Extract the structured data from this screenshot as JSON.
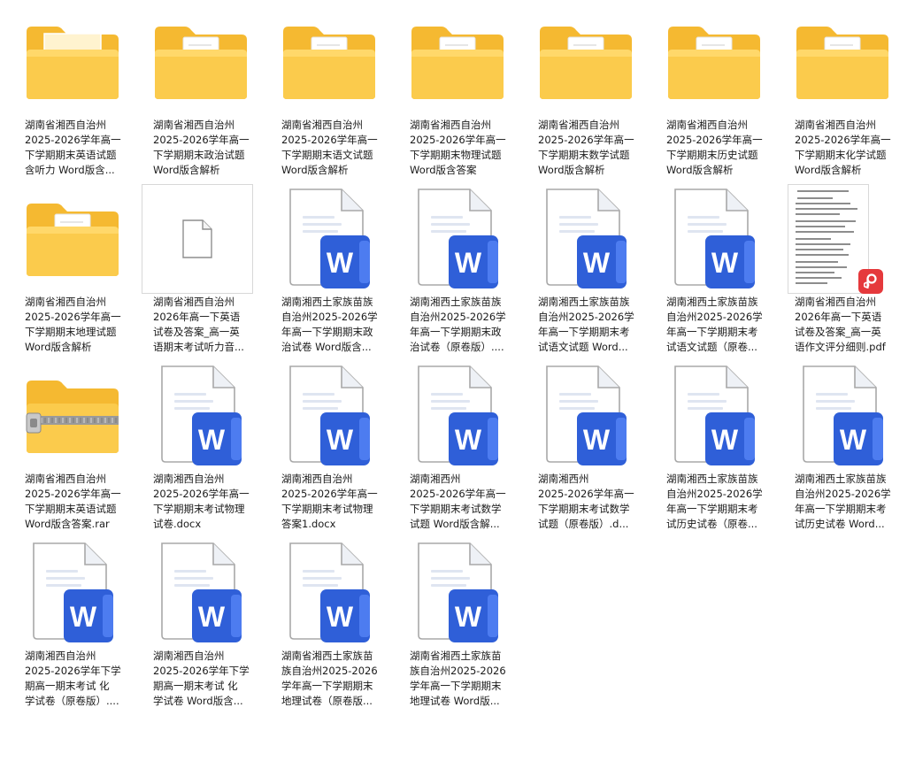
{
  "colors": {
    "folder_back": "#F5B931",
    "folder_front": "#FBCB4C",
    "word_blue": "#2F5FD8",
    "word_blue_light": "#4D7CF0",
    "pdf_red": "#E5393C"
  },
  "files": [
    {
      "type": "folder-image",
      "icon": "folder-icon",
      "lines": [
        "湖南省湘西自治州",
        "2025-2026学年高一",
        "下学期期末英语试题",
        "含听力 Word版含..."
      ]
    },
    {
      "type": "folder-doc",
      "icon": "folder-icon",
      "lines": [
        "湖南省湘西自治州",
        "2025-2026学年高一",
        "下学期期末政治试题",
        "Word版含解析"
      ]
    },
    {
      "type": "folder-doc",
      "icon": "folder-icon",
      "lines": [
        "湖南省湘西自治州",
        "2025-2026学年高一",
        "下学期期末语文试题",
        "Word版含解析"
      ]
    },
    {
      "type": "folder-doc",
      "icon": "folder-icon",
      "lines": [
        "湖南省湘西自治州",
        "2025-2026学年高一",
        "下学期期末物理试题",
        "Word版含答案"
      ]
    },
    {
      "type": "folder-doc",
      "icon": "folder-icon",
      "lines": [
        "湖南省湘西自治州",
        "2025-2026学年高一",
        "下学期期末数学试题",
        "Word版含解析"
      ]
    },
    {
      "type": "folder-doc",
      "icon": "folder-icon",
      "lines": [
        "湖南省湘西自治州",
        "2025-2026学年高一",
        "下学期期末历史试题",
        "Word版含解析"
      ]
    },
    {
      "type": "folder-doc",
      "icon": "folder-icon",
      "lines": [
        "湖南省湘西自治州",
        "2025-2026学年高一",
        "下学期期末化学试题",
        "Word版含解析"
      ]
    },
    {
      "type": "folder-doc",
      "icon": "folder-icon",
      "lines": [
        "湖南省湘西自治州",
        "2025-2026学年高一",
        "下学期期末地理试题",
        "Word版含解析"
      ]
    },
    {
      "type": "blank",
      "icon": "blank-file-icon",
      "lines": [
        "湖南省湘西自治州",
        "2026年高一下英语",
        "试卷及答案_高一英",
        "语期末考试听力音..."
      ]
    },
    {
      "type": "word",
      "icon": "word-doc-icon",
      "lines": [
        "湖南湘西土家族苗族",
        "自治州2025-2026学",
        "年高一下学期期末政",
        "治试卷 Word版含..."
      ]
    },
    {
      "type": "word",
      "icon": "word-doc-icon",
      "lines": [
        "湖南湘西土家族苗族",
        "自治州2025-2026学",
        "年高一下学期期末政",
        "治试卷（原卷版）...."
      ]
    },
    {
      "type": "word",
      "icon": "word-doc-icon",
      "lines": [
        "湖南湘西土家族苗族",
        "自治州2025-2026学",
        "年高一下学期期末考",
        "试语文试题 Word..."
      ]
    },
    {
      "type": "word",
      "icon": "word-doc-icon",
      "lines": [
        "湖南湘西土家族苗族",
        "自治州2025-2026学",
        "年高一下学期期末考",
        "试语文试题（原卷..."
      ]
    },
    {
      "type": "pdf",
      "icon": "pdf-file-icon",
      "lines": [
        "湖南省湘西自治州",
        "2026年高一下英语",
        "试卷及答案_高一英",
        "语作文评分细则.pdf"
      ]
    },
    {
      "type": "archive",
      "icon": "zip-folder-icon",
      "lines": [
        "湖南省湘西自治州",
        "2025-2026学年高一",
        "下学期期末英语试题",
        "Word版含答案.rar"
      ]
    },
    {
      "type": "word",
      "icon": "word-doc-icon",
      "lines": [
        "湖南湘西自治州",
        "2025-2026学年高一",
        "下学期期末考试物理",
        "试卷.docx"
      ]
    },
    {
      "type": "word",
      "icon": "word-doc-icon",
      "lines": [
        "湖南湘西自治州",
        "2025-2026学年高一",
        "下学期期末考试物理",
        "答案1.docx"
      ]
    },
    {
      "type": "word",
      "icon": "word-doc-icon",
      "lines": [
        "湖南湘西州",
        "2025-2026学年高一",
        "下学期期末考试数学",
        "试题 Word版含解..."
      ]
    },
    {
      "type": "word",
      "icon": "word-doc-icon",
      "lines": [
        "湖南湘西州",
        "2025-2026学年高一",
        "下学期期末考试数学",
        "试题（原卷版）.d..."
      ]
    },
    {
      "type": "word",
      "icon": "word-doc-icon",
      "lines": [
        "湖南湘西土家族苗族",
        "自治州2025-2026学",
        "年高一下学期期末考",
        "试历史试卷（原卷..."
      ]
    },
    {
      "type": "word",
      "icon": "word-doc-icon",
      "lines": [
        "湖南湘西土家族苗族",
        "自治州2025-2026学",
        "年高一下学期期末考",
        "试历史试卷 Word..."
      ]
    },
    {
      "type": "word",
      "icon": "word-doc-icon",
      "lines": [
        "湖南湘西自治州",
        "2025-2026学年下学",
        "期高一期末考试 化",
        "学试卷（原卷版）...."
      ]
    },
    {
      "type": "word",
      "icon": "word-doc-icon",
      "lines": [
        "湖南湘西自治州",
        "2025-2026学年下学",
        "期高一期末考试 化",
        "学试卷 Word版含..."
      ]
    },
    {
      "type": "word",
      "icon": "word-doc-icon",
      "lines": [
        "湖南省湘西土家族苗",
        "族自治州2025-2026",
        "学年高一下学期期末",
        "地理试卷（原卷版..."
      ]
    },
    {
      "type": "word",
      "icon": "word-doc-icon",
      "lines": [
        "湖南省湘西土家族苗",
        "族自治州2025-2026",
        "学年高一下学期期末",
        "地理试卷 Word版..."
      ]
    }
  ]
}
